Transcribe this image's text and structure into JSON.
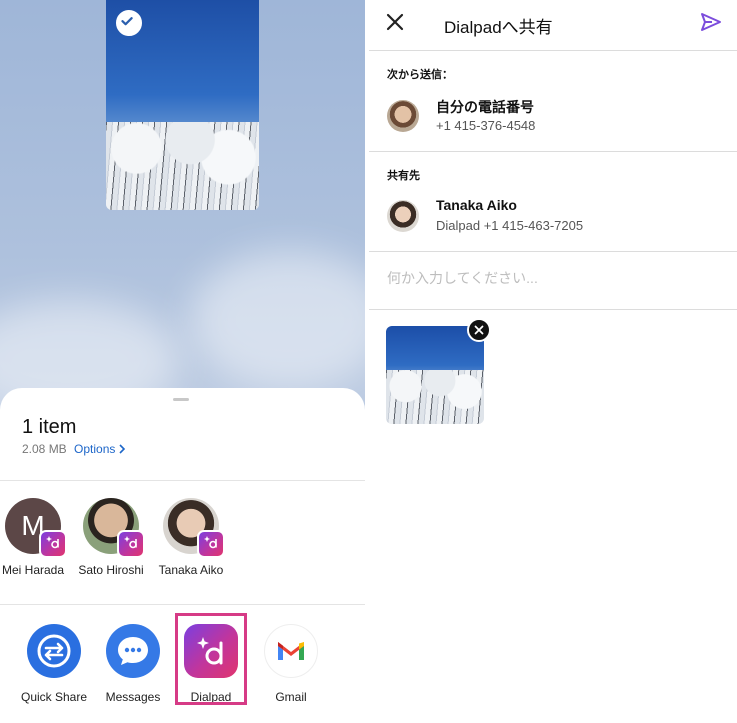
{
  "share_sheet": {
    "item_count": "1 item",
    "file_size": "2.08 MB",
    "options_label": "Options",
    "contacts": [
      {
        "initial": "M",
        "name": "Mei Harada"
      },
      {
        "initial": "",
        "name": "Sato Hiroshi"
      },
      {
        "initial": "",
        "name": "Tanaka Aiko"
      }
    ],
    "apps": [
      {
        "label": "Quick Share",
        "icon": "quick-share-icon"
      },
      {
        "label": "Messages",
        "icon": "messages-icon"
      },
      {
        "label": "Dialpad",
        "icon": "dialpad-icon"
      },
      {
        "label": "Gmail",
        "icon": "gmail-icon"
      }
    ],
    "highlighted_app": "Dialpad"
  },
  "compose": {
    "title": "Dialpadへ共有",
    "from_label": "次から送信：",
    "from_name": "自分の電話番号",
    "from_number": "+1 415-376-4548",
    "to_label": "共有先",
    "to_name": "Tanaka Aiko",
    "to_number": "Dialpad +1 415-463-7205",
    "message_placeholder": "何か入力してください...",
    "message_value": ""
  },
  "colors": {
    "accent_purple": "#7c4ddc",
    "link_blue": "#1d66c9",
    "highlight_pink": "#d63b86",
    "dialpad_gradient_start": "#7b3fe0",
    "dialpad_gradient_end": "#e0356e"
  }
}
